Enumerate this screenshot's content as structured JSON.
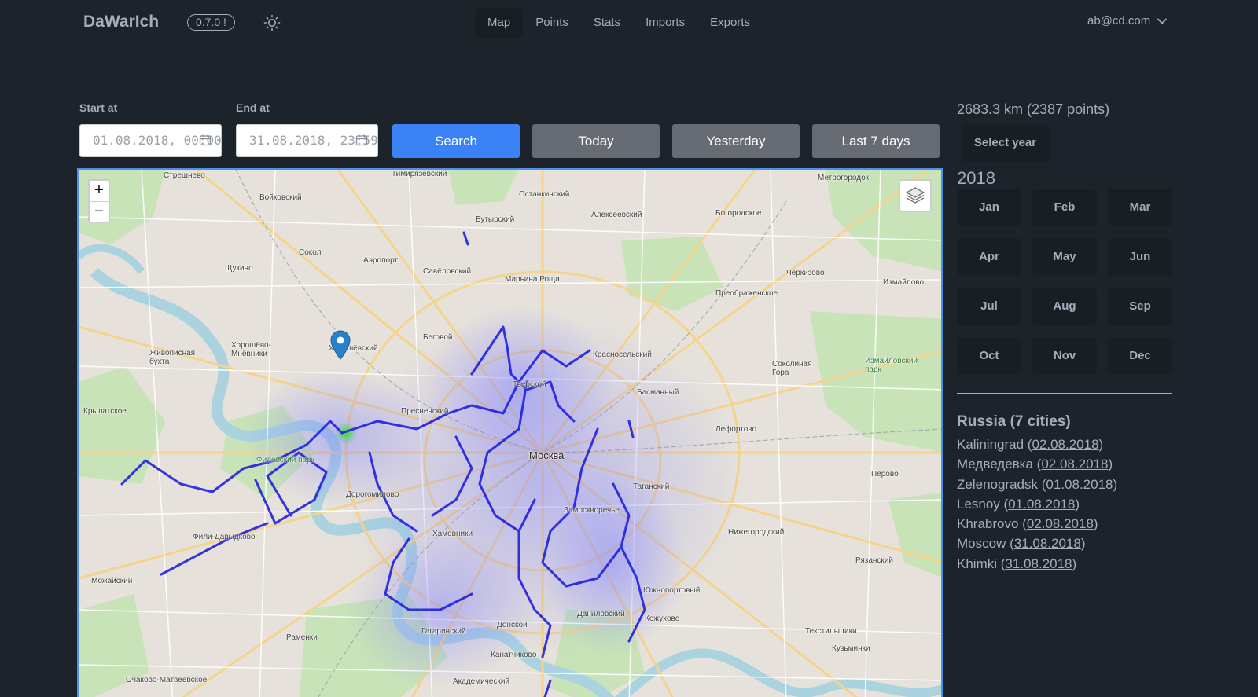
{
  "app": {
    "brand": "DaWarIch",
    "version": "0.7.0 !"
  },
  "nav": {
    "items": [
      {
        "label": "Map",
        "active": true
      },
      {
        "label": "Points",
        "active": false
      },
      {
        "label": "Stats",
        "active": false
      },
      {
        "label": "Imports",
        "active": false
      },
      {
        "label": "Exports",
        "active": false
      }
    ],
    "user_email": "ab@cd.com"
  },
  "filters": {
    "start_label": "Start at",
    "start_value": "01.08.2018, 00:00",
    "end_label": "End at",
    "end_value": "31.08.2018, 23:59",
    "search_label": "Search",
    "today_label": "Today",
    "yesterday_label": "Yesterday",
    "last7_label": "Last 7 days"
  },
  "map": {
    "zoom_in": "+",
    "zoom_out": "−",
    "labels": [
      "Стрешнево",
      "Войковский",
      "Тимирязевский",
      "Останкинский",
      "Метрогородок",
      "Алексеевский",
      "Бутырский",
      "Богородское",
      "Сокол",
      "Аэропорт",
      "Щукино",
      "Савёловский",
      "Марьина Роща",
      "Черкизово",
      "Измайлово",
      "Преображенское",
      "Хорошёвский",
      "Беговой",
      "Хорошёво-Мнёвники",
      "Красносельский",
      "Соколиная Гора",
      "Измайловский парк",
      "Басманный",
      "Тверской",
      "Пресненский",
      "Крылатское",
      "Лефортово",
      "Москва",
      "Дорогомилово",
      "Таганский",
      "Перово",
      "Замоскворечье",
      "Филёвский парк",
      "Хамовники",
      "Нижегородский",
      "Фили-Давыдково",
      "Рязанский",
      "Можайский",
      "Южнопортовый",
      "Даниловский",
      "Кожухово",
      "Донской",
      "Гагаринский",
      "Раменки",
      "Текстильщики",
      "Кузьминки",
      "Канатчиково",
      "Очаково-Матвеевское",
      "Академический",
      "Живописная бухта"
    ],
    "colors": {
      "track": "#2020e0",
      "heat": "#8080ff",
      "border": "#4e8fe8",
      "marker": "#2a81cb"
    }
  },
  "stats": {
    "distance_text": "2683.3 km (2387 points)",
    "select_year_label": "Select year",
    "year": "2018",
    "months": [
      "Jan",
      "Feb",
      "Mar",
      "Apr",
      "May",
      "Jun",
      "Jul",
      "Aug",
      "Sep",
      "Oct",
      "Nov",
      "Dec"
    ],
    "country_title": "Russia (7 cities)",
    "cities": [
      {
        "name": "Kaliningrad",
        "date": "02.08.2018"
      },
      {
        "name": "Медведевка",
        "date": "02.08.2018"
      },
      {
        "name": "Zelenogradsk",
        "date": "01.08.2018"
      },
      {
        "name": "Lesnoy",
        "date": "01.08.2018"
      },
      {
        "name": "Khrabrovo",
        "date": "02.08.2018"
      },
      {
        "name": "Moscow",
        "date": "31.08.2018"
      },
      {
        "name": "Khimki",
        "date": "31.08.2018"
      }
    ]
  },
  "icons": {
    "theme": "sun-icon",
    "dropdown": "chevron-down-icon",
    "calendar": "calendar-icon",
    "layers": "layers-icon",
    "marker": "map-marker-icon"
  }
}
